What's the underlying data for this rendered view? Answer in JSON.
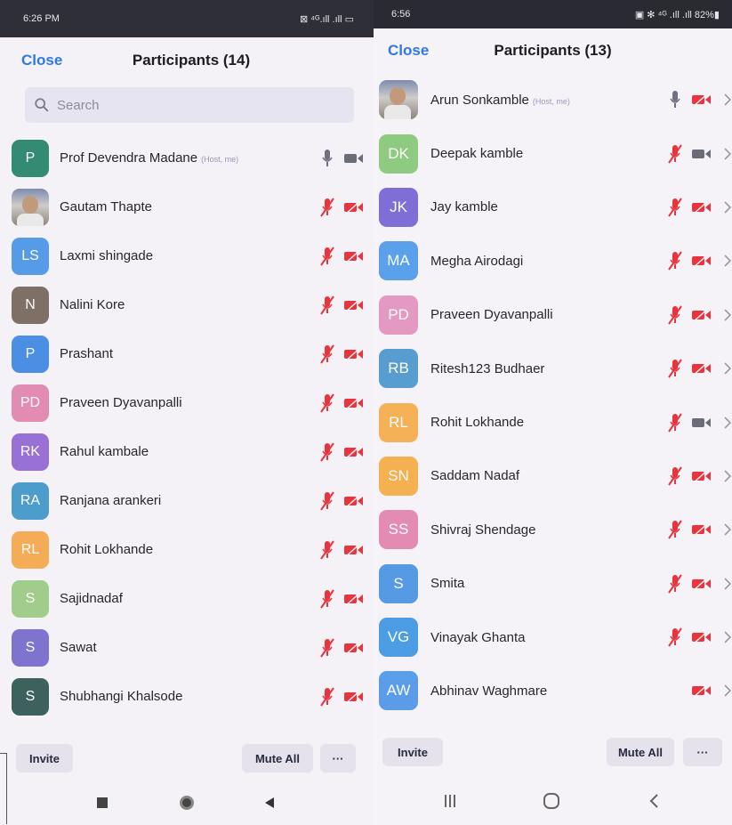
{
  "left": {
    "status": {
      "time": "6:26 PM",
      "right": "⊠ ⁴ᴳ.ıll .ıll ▭"
    },
    "close_label": "Close",
    "title": "Participants (14)",
    "search_placeholder": "Search",
    "participants": [
      {
        "initials": "P",
        "name": "Prof Devendra Madane",
        "tag": "(Host, me)",
        "color": "#127a5c",
        "mic": "on",
        "video": "on"
      },
      {
        "initials": "",
        "name": "Gautam Thapte",
        "tag": "",
        "color": "",
        "photo": true,
        "mic": "muted",
        "video": "off"
      },
      {
        "initials": "LS",
        "name": "Laxmi shingade",
        "tag": "",
        "color": "#3b8de6",
        "mic": "muted",
        "video": "off"
      },
      {
        "initials": "N",
        "name": "Nalini Kore",
        "tag": "",
        "color": "#6b5a4e",
        "mic": "muted",
        "video": "off"
      },
      {
        "initials": "P",
        "name": "Prashant",
        "tag": "",
        "color": "#2d7fe0",
        "mic": "muted",
        "video": "off"
      },
      {
        "initials": "PD",
        "name": "Praveen Dyavanpalli",
        "tag": "",
        "color": "#e07aa8",
        "mic": "muted",
        "video": "off"
      },
      {
        "initials": "RK",
        "name": "Rahul kambale",
        "tag": "",
        "color": "#8a5bd1",
        "mic": "muted",
        "video": "off"
      },
      {
        "initials": "RA",
        "name": "Ranjana arankeri",
        "tag": "",
        "color": "#2f8fc4",
        "mic": "muted",
        "video": "off"
      },
      {
        "initials": "RL",
        "name": "Rohit Lokhande",
        "tag": "",
        "color": "#f4a23a",
        "mic": "muted",
        "video": "off"
      },
      {
        "initials": "S",
        "name": "Sajidnadaf",
        "tag": "",
        "color": "#94c67a",
        "mic": "muted",
        "video": "off"
      },
      {
        "initials": "S",
        "name": "Sawat",
        "tag": "",
        "color": "#6a5ec9",
        "mic": "muted",
        "video": "off"
      },
      {
        "initials": "S",
        "name": "Shubhangi Khalsode",
        "tag": "",
        "color": "#1e4a44",
        "mic": "muted",
        "video": "off"
      }
    ],
    "invite_label": "Invite",
    "mute_all_label": "Mute All",
    "more_label": "···"
  },
  "right": {
    "status": {
      "time": "6:56",
      "right": "▣ ✻ ⁴ᴳ .ıll .ıll 82%▮"
    },
    "close_label": "Close",
    "title": "Participants (13)",
    "participants": [
      {
        "initials": "",
        "name": "Arun Sonkamble",
        "tag": "(Host, me)",
        "color": "",
        "photo": true,
        "mic": "on",
        "video": "off"
      },
      {
        "initials": "DK",
        "name": "Deepak kamble",
        "tag": "",
        "color": "#7cc46a",
        "mic": "muted",
        "video": "on"
      },
      {
        "initials": "JK",
        "name": "Jay kamble",
        "tag": "",
        "color": "#6b57cf",
        "mic": "muted",
        "video": "off"
      },
      {
        "initials": "MA",
        "name": "Megha Airodagi",
        "tag": "",
        "color": "#3f92e8",
        "mic": "muted",
        "video": "off"
      },
      {
        "initials": "PD",
        "name": "Praveen Dyavanpalli",
        "tag": "",
        "color": "#e08ab8",
        "mic": "muted",
        "video": "off"
      },
      {
        "initials": "RB",
        "name": "Ritesh123 Budhaer",
        "tag": "",
        "color": "#3c8fc8",
        "mic": "muted",
        "video": "off"
      },
      {
        "initials": "RL",
        "name": "Rohit Lokhande",
        "tag": "",
        "color": "#f5a63c",
        "mic": "muted",
        "video": "on"
      },
      {
        "initials": "SN",
        "name": "Saddam Nadaf",
        "tag": "",
        "color": "#f4a534",
        "mic": "muted",
        "video": "off"
      },
      {
        "initials": "SS",
        "name": "Shivraj Shendage",
        "tag": "",
        "color": "#e27aa8",
        "mic": "muted",
        "video": "off"
      },
      {
        "initials": "S",
        "name": "Smita",
        "tag": "",
        "color": "#3b8ae2",
        "mic": "muted",
        "video": "off"
      },
      {
        "initials": "VG",
        "name": "Vinayak Ghanta",
        "tag": "",
        "color": "#2f8fe0",
        "mic": "muted",
        "video": "off"
      },
      {
        "initials": "AW",
        "name": "Abhinav Waghmare",
        "tag": "",
        "color": "#3f8ee6",
        "mic": "none",
        "video": "off"
      }
    ],
    "invite_label": "Invite",
    "mute_all_label": "Mute All",
    "more_label": "···"
  },
  "colors": {
    "accent": "#2e78ea",
    "muted_red": "#e8343d",
    "icon_gray": "#6c6c78"
  }
}
